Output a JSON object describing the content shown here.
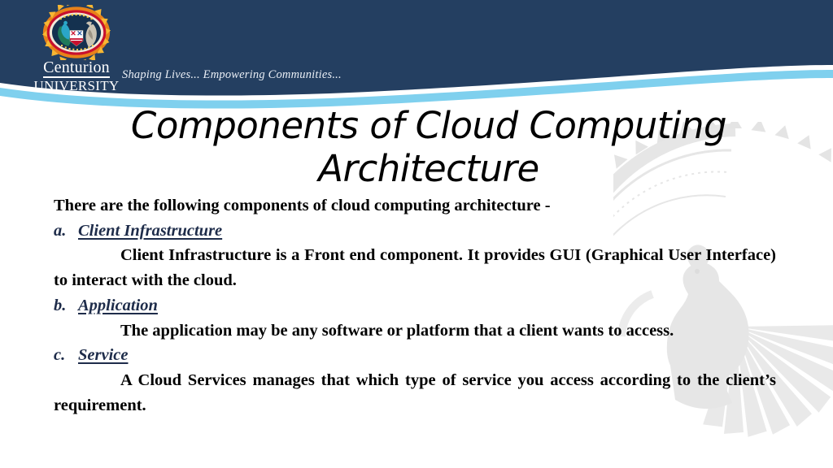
{
  "brand": {
    "crest_alt": "centurion-university-crest",
    "name_line1": "Centurion",
    "name_line2": "UNIVERSITY",
    "tagline": "Shaping Lives... Empowering Communities...",
    "navy": "#243F61",
    "sky": "#7FD0EE",
    "crest_ring": "#E8821A",
    "crest_ring_alt": "#C8102E"
  },
  "slide": {
    "title_line1": "Components of Cloud Computing",
    "title_line2": "Architecture",
    "lead": "There are the following components of cloud computing architecture -",
    "items": [
      {
        "marker": "a.",
        "term": "Client Infrastructure",
        "body": "Client Infrastructure is a Front end component. It provides GUI (Graphical User Interface)  to interact with the cloud."
      },
      {
        "marker": "b.",
        "term": "Application",
        "body": "The application may be any software or platform that a client wants to access."
      },
      {
        "marker": "c.",
        "term": "Service",
        "body": "A Cloud Services manages that which type of service you access according to the client’s requirement."
      }
    ]
  },
  "watermark": {
    "name": "peacock-watermark",
    "color": "#E8E8E8"
  }
}
